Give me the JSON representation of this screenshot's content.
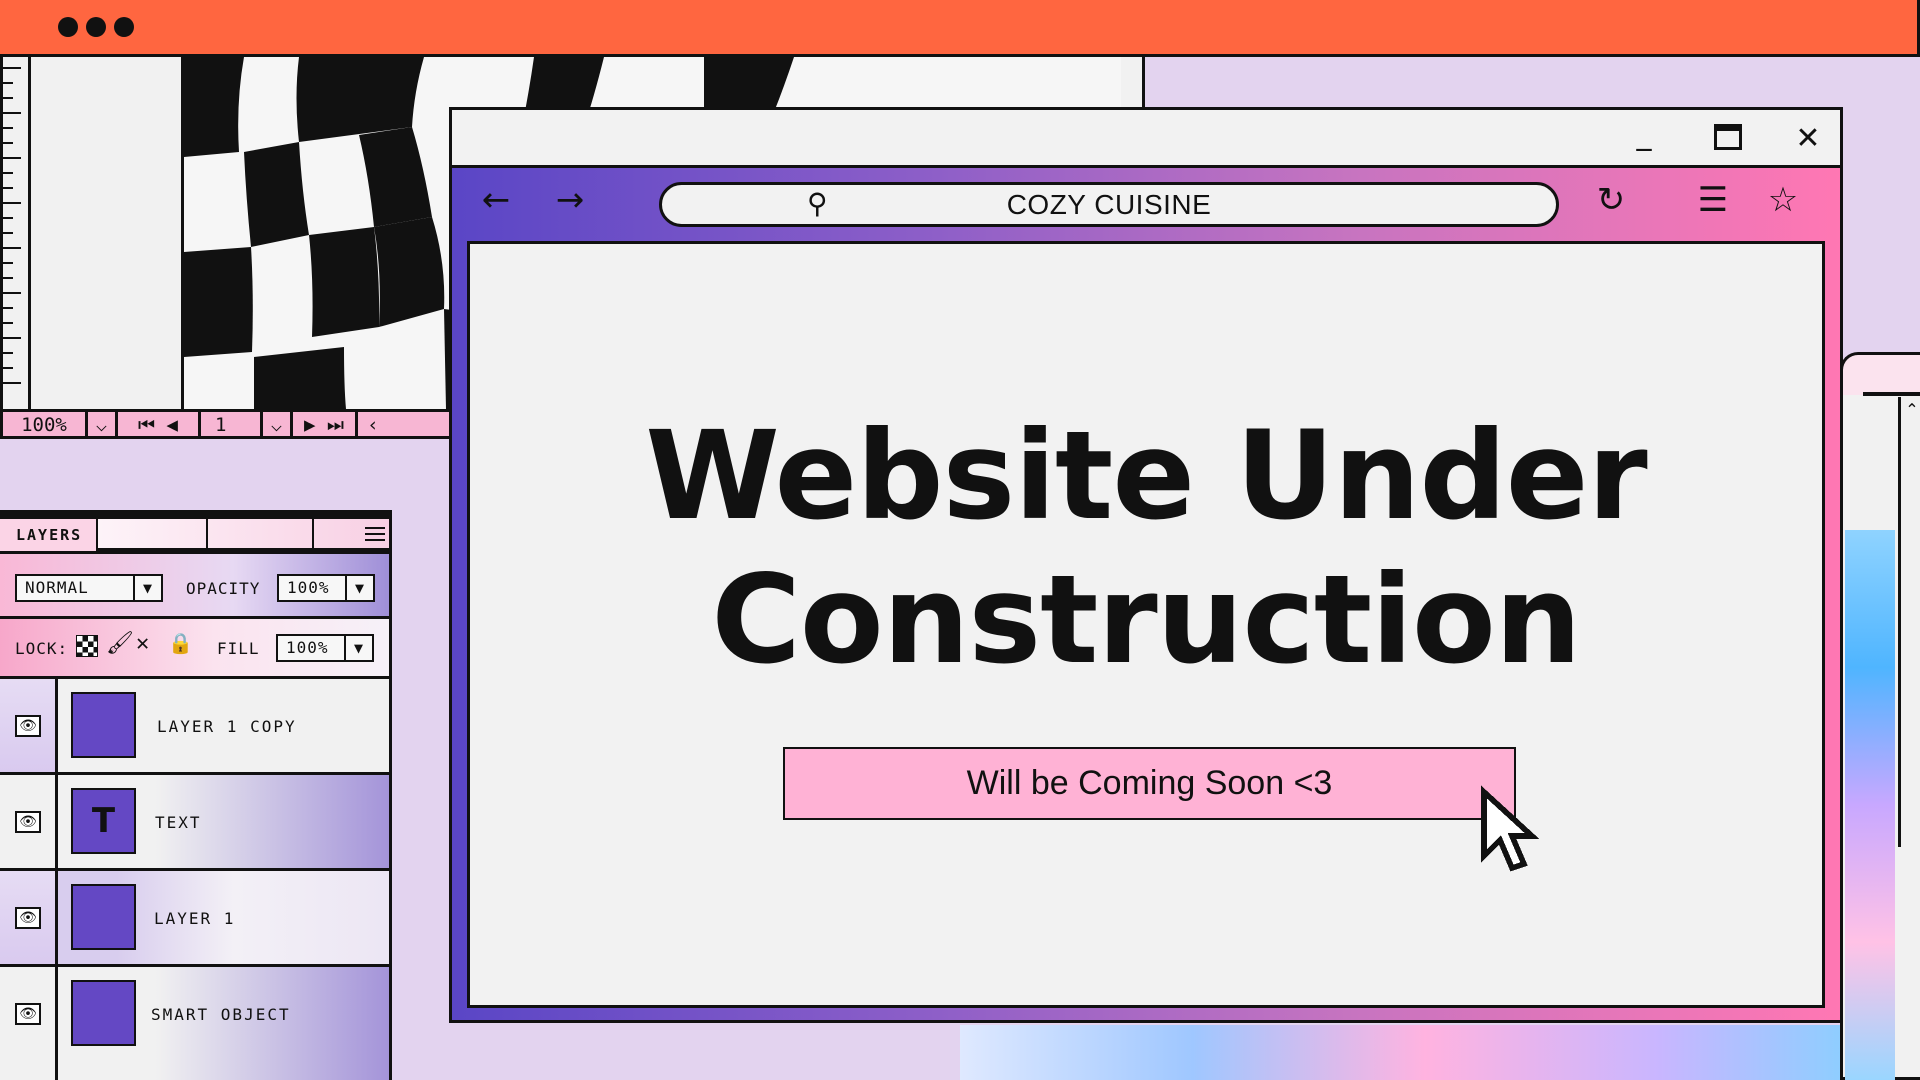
{
  "editor": {
    "zoom": "100%",
    "page_number": "1"
  },
  "layers_panel": {
    "title": "LAYERS",
    "blend_mode": "NORMAL",
    "opacity_label": "OPACITY",
    "opacity_value": "100%",
    "lock_label": "LOCK:",
    "fill_label": "FILL",
    "fill_value": "100%",
    "layers": [
      {
        "name": "LAYER 1 COPY",
        "thumb_text": ""
      },
      {
        "name": "TEXT",
        "thumb_text": "T"
      },
      {
        "name": "LAYER 1",
        "thumb_text": ""
      },
      {
        "name": "SMART OBJECT",
        "thumb_text": ""
      }
    ]
  },
  "browser": {
    "url_text": "COZY CUISINE",
    "headline_line1": "Website Under",
    "headline_line2": "Construction",
    "cta_label": "Will be Coming Soon <3"
  },
  "colors": {
    "top_bar": "#ff6640",
    "layer_thumb": "#6448c4",
    "cta_bg": "#ffb2d5",
    "browser_gradient_start": "#5a46c6",
    "browser_gradient_end": "#ff77b3"
  }
}
